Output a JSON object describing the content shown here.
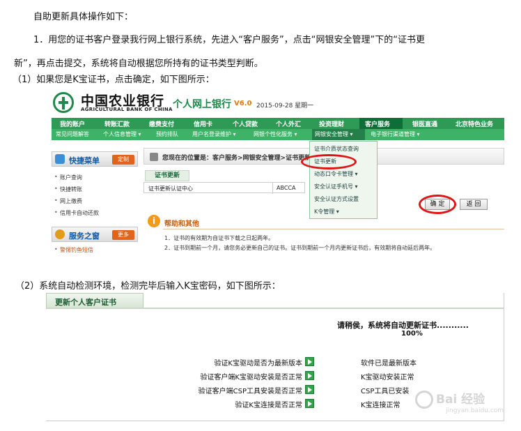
{
  "intro": "自助更新具体操作如下：",
  "step1_line1": "1．用您的证书客户登录我行网上银行系统，先进入“客户服务”，点击“网银安全管理”下的“证书更",
  "step1_line2": "新”，再点击提交，系统将自动根据您所持有的证书类型判断。",
  "case1": "（1）如果您是K宝证书，点击确定，如下图所示：",
  "case2": "（2）系统自动检测环境，检测完毕后输入K宝密码，如下图所示：",
  "shot1": {
    "bank_name": "中国农业银行",
    "bank_name_en": "AGRICULTURAL BANK OF CHINA",
    "portal": "个人网上银行",
    "version": "V6.0",
    "date": "2015-09-28 星期一",
    "nav1": [
      "我的账户",
      "转账汇款",
      "缴费支付",
      "信用卡",
      "个人贷款",
      "个人外汇",
      "投资理财",
      "客户服务",
      "银医直通",
      "北京特色业务"
    ],
    "nav2": [
      "常见问题解答",
      "个人信息管理 ▾",
      "预约排队",
      "用户名登录维护 ▾",
      "网银个性化服务 ▾",
      "网银安全管理 ▾",
      "电子银行渠道管理 ▾"
    ],
    "quick_menu": "快捷菜单",
    "customize": "定制",
    "quick_items": [
      "账户查询",
      "快捷转账",
      "网上缴费",
      "信用卡自动还款"
    ],
    "service_window": "服务之窗",
    "more": "更多",
    "service_items": [
      "警惕钓鱼短信"
    ],
    "location": "您现在的位置是：客户服务>网银安全管理>证书更新",
    "cert_tab": "证书更新",
    "cert_row_label": "证书更新认证中心",
    "cert_row_value": "ABCCA",
    "dropdown": [
      "证书介质状态查询",
      "证书更新",
      "动态口令卡管理 ▾",
      "安全认证手机号 ▾",
      "安全认证方式设置",
      "K令管理 ▾"
    ],
    "help_title": "帮助和其他",
    "help1": "1．证书的有效期为自证书下载之日起两年。",
    "help2": "2．证书到期前一个月，请您务必更新自己的证书。证书到期前一个月内更新证书后，有效期将自动延后两年。",
    "confirm": "确 定",
    "back": "返 回"
  },
  "shot2": {
    "tab": "更新个人客户证书",
    "wait": "请稍侯，系统将自动更新证书...........",
    "percent": "100%",
    "checks": [
      "验证K宝驱动是否为最新版本",
      "验证客户端K宝驱动安装是否正常",
      "验证客户端CSP工具安装是否正常",
      "验证K宝连接是否正常"
    ],
    "results": [
      "软件已是最新版本",
      "K宝驱动安装正常",
      "CSP工具已安装",
      "K宝连接正常"
    ]
  },
  "watermark": {
    "text": "Bai 经验",
    "sub": "jingyan.baidu.com"
  }
}
